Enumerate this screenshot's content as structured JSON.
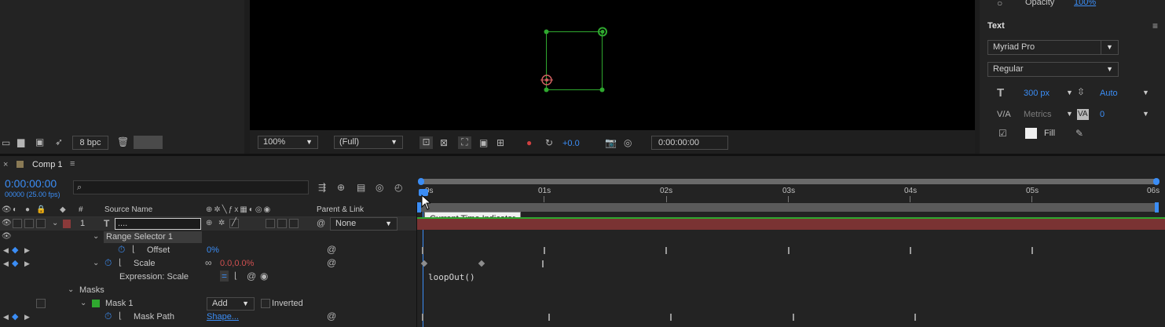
{
  "project": {
    "bpc": "8 bpc"
  },
  "viewer": {
    "zoom": "100%",
    "resolution": "(Full)",
    "exposure": "+0.0",
    "timecode": "0:00:00:00"
  },
  "right_panel": {
    "opacity_label": "Opacity",
    "opacity_value": "100%",
    "text_section": "Text",
    "font": "Myriad Pro",
    "style": "Regular",
    "size": "300 px",
    "leading": "Auto",
    "kerning": "Metrics",
    "tracking": "0",
    "fill_label": "Fill"
  },
  "timeline": {
    "comp_tab": "Comp 1",
    "current_time": "0:00:00:00",
    "frame_info": "00000 (25.00 fps)",
    "search_placeholder": "",
    "col_number": "#",
    "col_source": "Source Name",
    "col_parent": "Parent & Link",
    "ticks": [
      "0s",
      "01s",
      "02s",
      "03s",
      "04s",
      "05s",
      "06s"
    ],
    "tooltip": "Current Time Indicator",
    "expression_text": "loopOut()",
    "colors": {
      "accent": "#3b8df5",
      "layer_bar": "#8a3a3a",
      "mask_green": "#2fa82f"
    },
    "layers": {
      "layer1_num": "1",
      "layer1_name": "....",
      "layer1_parent": "None",
      "range_selector": "Range Selector 1",
      "offset_label": "Offset",
      "offset_value": "0%",
      "scale_label": "Scale",
      "scale_value": "0.0,0.0%",
      "expr_scale_label": "Expression: Scale",
      "masks_label": "Masks",
      "mask1_label": "Mask 1",
      "mask_mode": "Add",
      "inverted_label": "Inverted",
      "mask_path_label": "Mask Path",
      "mask_path_value": "Shape..."
    }
  }
}
